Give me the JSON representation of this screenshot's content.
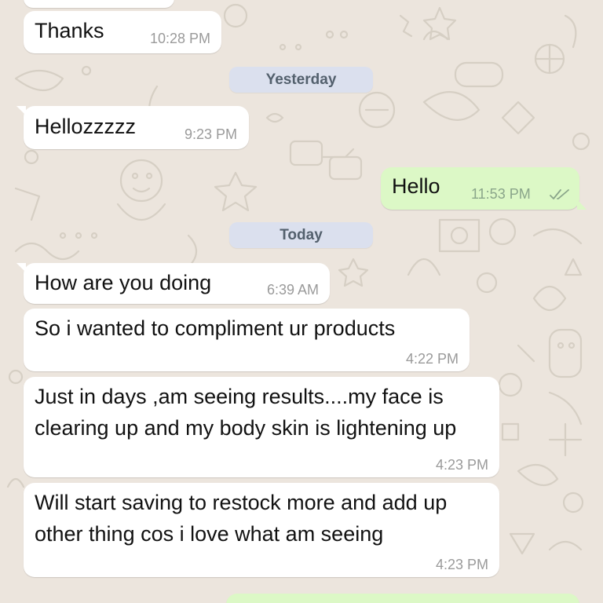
{
  "chat": {
    "messages": [
      {
        "direction": "incoming",
        "text": "Thanks",
        "time": "10:28 PM"
      },
      {
        "separator": "Yesterday"
      },
      {
        "direction": "incoming",
        "text": "Hellozzzzz",
        "time": "9:23 PM"
      },
      {
        "direction": "outgoing",
        "text": "Hello",
        "time": "11:53 PM",
        "status_icon": "double-check-icon"
      },
      {
        "separator": "Today"
      },
      {
        "direction": "incoming",
        "text": "How are you doing",
        "time": "6:39 AM"
      },
      {
        "direction": "incoming",
        "text": "So i wanted to compliment ur products",
        "time": "4:22 PM"
      },
      {
        "direction": "incoming",
        "text": "Just in days ,am seeing results....my face is clearing up and my body skin is lightening up",
        "time": "4:23 PM"
      },
      {
        "direction": "incoming",
        "text": "Will start saving to restock more and add up other thing cos i love what am seeing",
        "time": "4:23 PM"
      }
    ]
  },
  "colors": {
    "background": "#ece5dd",
    "incoming_bubble": "#ffffff",
    "outgoing_bubble": "#dcf8c6",
    "date_pill": "#dbe0ee",
    "timestamp": "#9a9a9a"
  }
}
